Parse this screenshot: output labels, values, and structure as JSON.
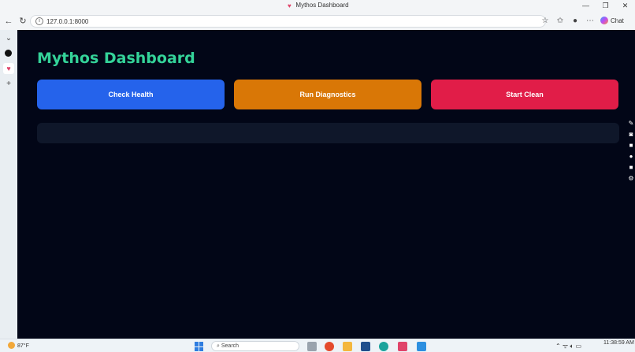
{
  "browser": {
    "tab_title": "Mythos Dashboard",
    "url": "127.0.0.1:8000",
    "chat_label": "Chat"
  },
  "dashboard": {
    "title": "Mythos Dashboard",
    "buttons": [
      {
        "label": "Check Health",
        "color": "#2563eb"
      },
      {
        "label": "Run Diagnostics",
        "color": "#d97706"
      },
      {
        "label": "Start Clean",
        "color": "#e11d48"
      }
    ],
    "output_text": ""
  },
  "taskbar": {
    "weather_temp": "87°F",
    "search_placeholder": "Search",
    "time": "11:38:59 AM"
  },
  "icons": {
    "back": "arrow-left-icon",
    "refresh": "refresh-icon",
    "star": "star-icon",
    "favorites": "favorites-icon",
    "profile": "profile-icon",
    "more": "more-icon"
  }
}
